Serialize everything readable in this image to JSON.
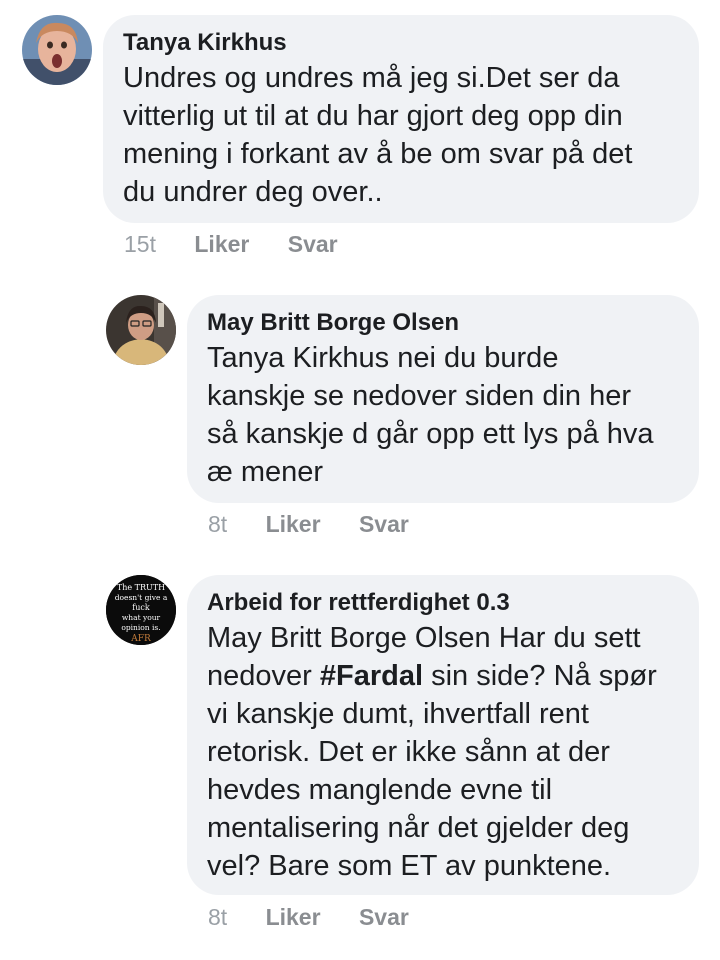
{
  "comments": [
    {
      "author": "Tanya Kirkhus",
      "text": "Undres og undres må jeg si.Det ser da\nvitterlig ut til at du har gjort deg opp din\nmening i forkant av å be om svar på det\ndu undrer deg over..",
      "time": "15t",
      "like_label": "Liker",
      "reply_label": "Svar",
      "avatar_icon": "user-avatar-icon"
    },
    {
      "author": "May Britt Borge Olsen",
      "text": "Tanya Kirkhus nei du burde\nkanskje se nedover siden din her\nså kanskje d går opp ett lys på hva\næ mener",
      "time": "8t",
      "like_label": "Liker",
      "reply_label": "Svar",
      "avatar_icon": "user-avatar-icon"
    },
    {
      "author": "Arbeid for rettferdighet 0.3",
      "text_before": "May Britt Borge Olsen Har du sett\nnedover ",
      "hashtag": "#Fardal",
      "text_after": " sin side? Nå spør\nvi kanskje dumt, ihvertfall rent\nretorisk. Det er ikke sånn at der\nhevdes manglende evne til\nmentalisering når det gjelder deg\nvel? Bare som ET av punktene.",
      "time": "8t",
      "like_label": "Liker",
      "reply_label": "Svar",
      "avatar_icon": "page-logo-icon",
      "avatar_text": [
        "The TRUTH",
        "doesn't give a",
        "fuck",
        "what your",
        "opinion is.",
        "AFR"
      ]
    }
  ],
  "colors": {
    "bubble": "#f0f2f5",
    "text": "#1c1e21",
    "meta": "#8a8d91"
  }
}
